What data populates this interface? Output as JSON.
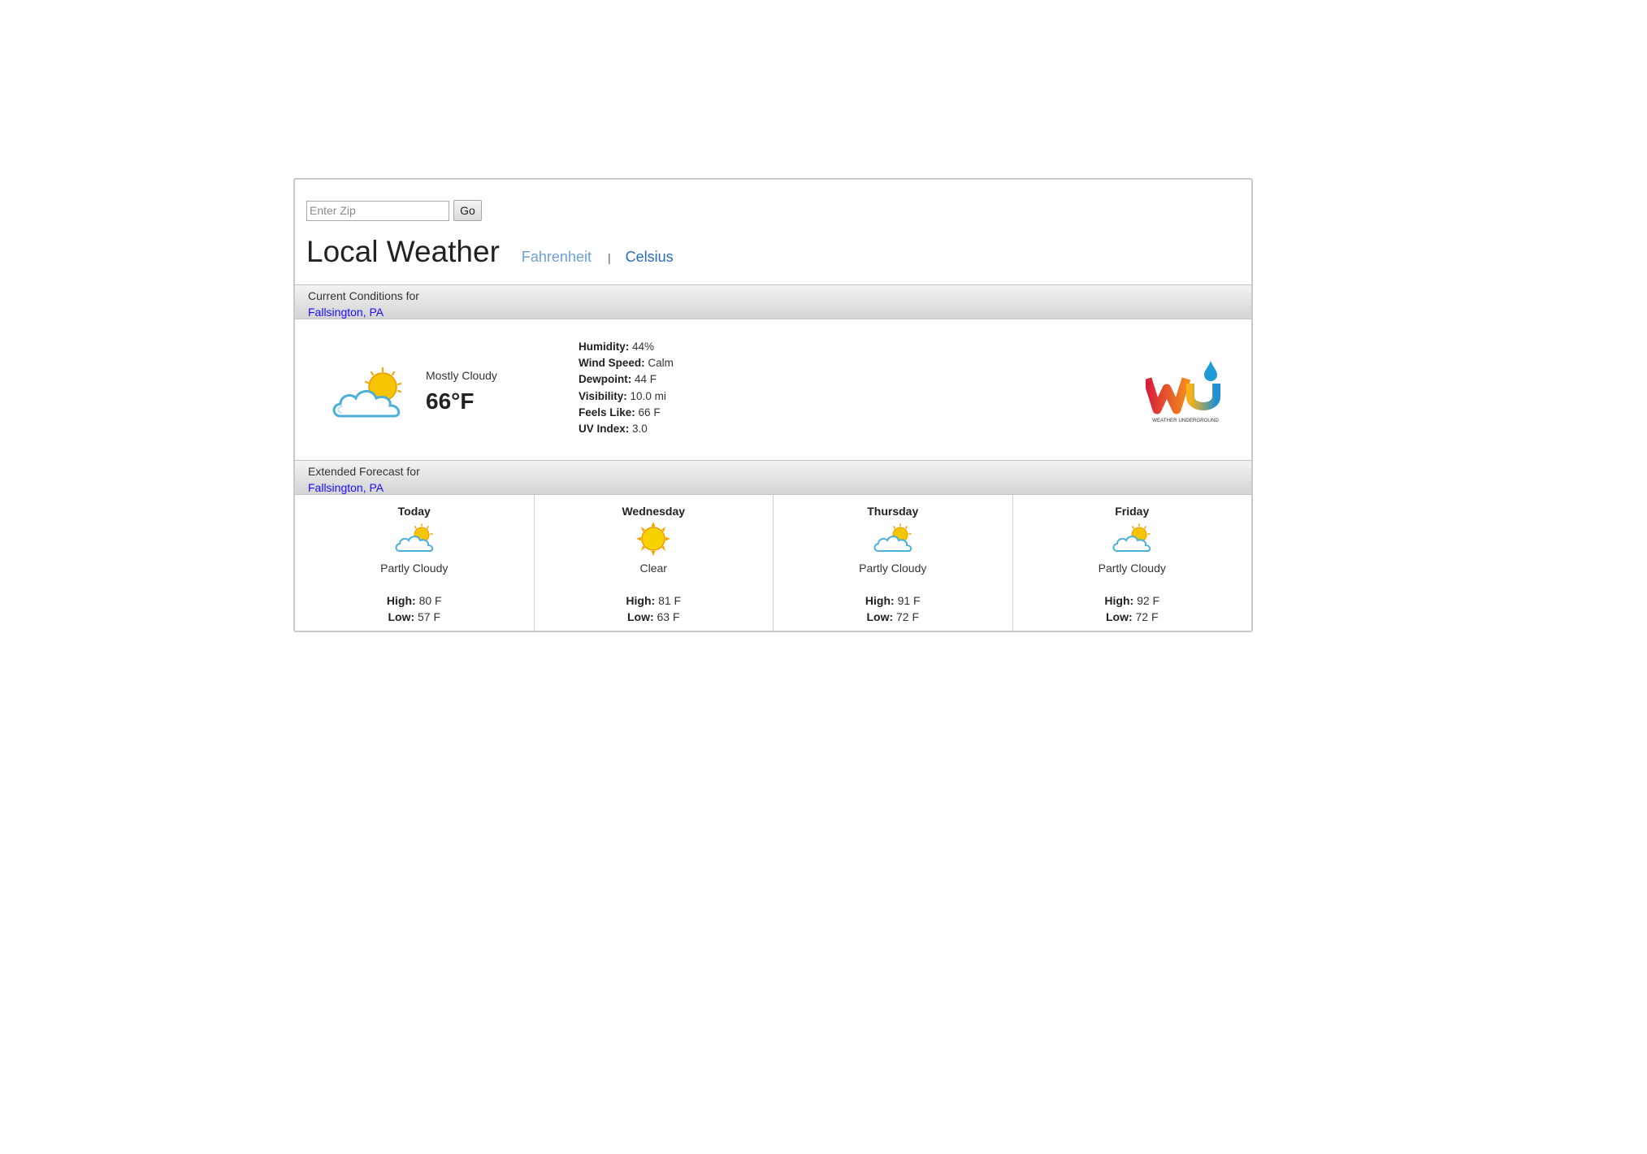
{
  "search": {
    "placeholder": "Enter Zip",
    "value": "",
    "button_label": "Go"
  },
  "header": {
    "title": "Local Weather",
    "fahrenheit_label": "Fahrenheit",
    "separator": "|",
    "celsius_label": "Celsius"
  },
  "current": {
    "section_label": "Current Conditions for",
    "location": "Fallsington, PA",
    "condition": "Mostly Cloudy",
    "temperature": "66°F",
    "icon": "mostly-cloudy-icon",
    "details": [
      {
        "label": "Humidity:",
        "value": "44%"
      },
      {
        "label": "Wind Speed:",
        "value": "Calm"
      },
      {
        "label": "Dewpoint:",
        "value": "44 F"
      },
      {
        "label": "Visibility:",
        "value": "10.0 mi"
      },
      {
        "label": "Feels Like:",
        "value": "66 F"
      },
      {
        "label": "UV Index:",
        "value": "3.0"
      }
    ],
    "logo_text": "WEATHER UNDERGROUND"
  },
  "forecast": {
    "section_label": "Extended Forecast for",
    "location": "Fallsington, PA",
    "high_label": "High:",
    "low_label": "Low:",
    "days": [
      {
        "name": "Today",
        "condition": "Partly Cloudy",
        "icon": "partly-cloudy-icon",
        "high": "80 F",
        "low": "57 F"
      },
      {
        "name": "Wednesday",
        "condition": "Clear",
        "icon": "sun-icon",
        "high": "81 F",
        "low": "63 F"
      },
      {
        "name": "Thursday",
        "condition": "Partly Cloudy",
        "icon": "partly-cloudy-icon",
        "high": "91 F",
        "low": "72 F"
      },
      {
        "name": "Friday",
        "condition": "Partly Cloudy",
        "icon": "partly-cloudy-icon",
        "high": "92 F",
        "low": "72 F"
      }
    ]
  },
  "colors": {
    "link": "#1a0dff",
    "unit_active": "#2a6cb7",
    "unit_inactive": "#6fa0cf",
    "cloud_outline": "#4cb0d8",
    "sun": "#f5b800"
  }
}
